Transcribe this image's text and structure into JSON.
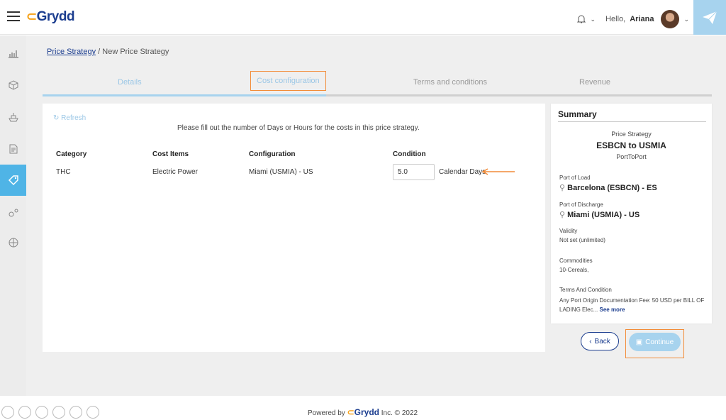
{
  "header": {
    "logo_text": "Grydd",
    "greeting": "Hello,",
    "user_name": "Ariana"
  },
  "breadcrumb": {
    "parent": "Price Strategy",
    "separator": "/",
    "current": "New Price Strategy"
  },
  "tabs": [
    {
      "label": "Details"
    },
    {
      "label": "Cost configuration"
    },
    {
      "label": "Terms and conditions"
    },
    {
      "label": "Revenue"
    }
  ],
  "content": {
    "refresh_label": "Refresh",
    "instruction": "Please fill out the number of Days or Hours for the costs in this price strategy.",
    "columns": [
      "Category",
      "Cost Items",
      "Configuration",
      "Condition"
    ],
    "row": {
      "category": "THC",
      "cost_item": "Electric Power",
      "configuration": "Miami (USMIA) - US",
      "condition_value": "5.0",
      "condition_unit": "Calendar Days"
    }
  },
  "summary": {
    "title": "Summary",
    "strategy_label": "Price Strategy",
    "strategy_name": "ESBCN to USMIA",
    "strategy_type": "PortToPort",
    "pol_label": "Port of Load",
    "pol_value": "Barcelona (ESBCN) - ES",
    "pod_label": "Port of Discharge",
    "pod_value": "Miami (USMIA) - US",
    "validity_label": "Validity",
    "validity_value": "Not set (unlimited)",
    "commodities_label": "Commodities",
    "commodities_value": "10-Cereals,",
    "terms_label": "Terms And Condition",
    "terms_value": "Any Port Origin Documentation Fee: 50 USD per BILL OF LADING Elec...",
    "see_more": "See more"
  },
  "buttons": {
    "back": "Back",
    "continue": "Continue"
  },
  "footer": {
    "powered_by": "Powered by",
    "brand": "Grydd",
    "suffix": "Inc. © 2022"
  },
  "colors": {
    "accent": "#a7d3ee",
    "brand": "#1b3d8f",
    "highlight": "#f28c38",
    "sidebar_active": "#4fb4e6"
  }
}
